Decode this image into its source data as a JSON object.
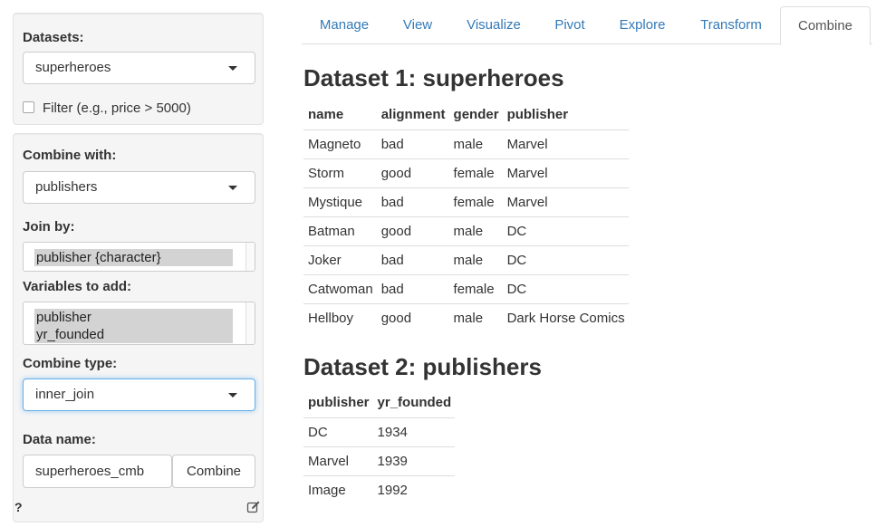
{
  "sidebar": {
    "datasets_label": "Datasets:",
    "datasets_value": "superheroes",
    "filter_label": "Filter (e.g., price > 5000)",
    "combine_with_label": "Combine with:",
    "combine_with_value": "publishers",
    "join_by_label": "Join by:",
    "join_by_options": [
      "publisher {character}"
    ],
    "vars_label": "Variables to add:",
    "vars_options": [
      "publisher",
      "yr_founded"
    ],
    "combine_type_label": "Combine type:",
    "combine_type_value": "inner_join",
    "data_name_label": "Data name:",
    "data_name_value": "superheroes_cmb",
    "combine_button": "Combine",
    "help": "?"
  },
  "tabs": [
    "Manage",
    "View",
    "Visualize",
    "Pivot",
    "Explore",
    "Transform",
    "Combine"
  ],
  "active_tab": "Combine",
  "dataset1": {
    "title": "Dataset 1: superheroes",
    "columns": [
      "name",
      "alignment",
      "gender",
      "publisher"
    ],
    "rows": [
      [
        "Magneto",
        "bad",
        "male",
        "Marvel"
      ],
      [
        "Storm",
        "good",
        "female",
        "Marvel"
      ],
      [
        "Mystique",
        "bad",
        "female",
        "Marvel"
      ],
      [
        "Batman",
        "good",
        "male",
        "DC"
      ],
      [
        "Joker",
        "bad",
        "male",
        "DC"
      ],
      [
        "Catwoman",
        "bad",
        "female",
        "DC"
      ],
      [
        "Hellboy",
        "good",
        "male",
        "Dark Horse Comics"
      ]
    ]
  },
  "dataset2": {
    "title": "Dataset 2: publishers",
    "columns": [
      "publisher",
      "yr_founded"
    ],
    "rows": [
      [
        "DC",
        "1934"
      ],
      [
        "Marvel",
        "1939"
      ],
      [
        "Image",
        "1992"
      ]
    ]
  },
  "colors": {
    "link": "#337ab7",
    "well_bg": "#f5f5f5",
    "selected_option": "#d3d3d3",
    "focus": "#66afe9"
  },
  "icons": {
    "edit": "edit-icon",
    "dropdown": "caret-down-icon",
    "checkbox": "checkbox-icon"
  }
}
